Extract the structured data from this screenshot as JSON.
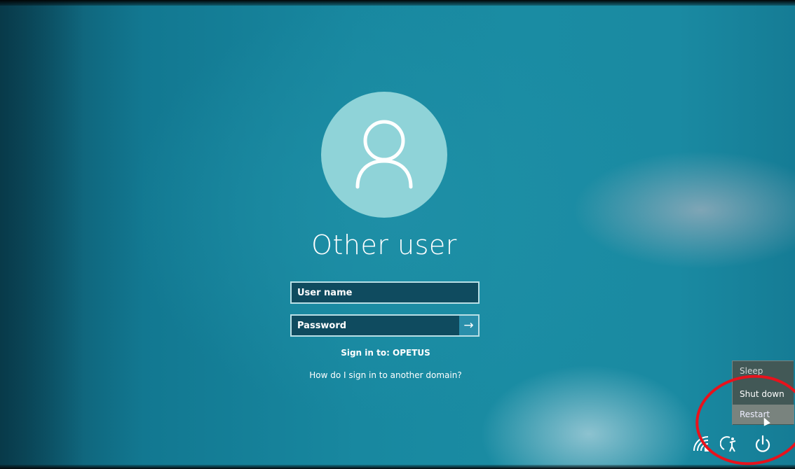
{
  "lock_screen": {
    "avatar_icon": "user-silhouette-icon",
    "title": "Other user",
    "username_placeholder": "User name",
    "password_placeholder": "Password",
    "submit_icon": "arrow-right-icon",
    "submit_glyph": "→",
    "sign_in_to": "Sign in to: OPETUS",
    "domain_help_link": "How do I sign in to another domain?"
  },
  "power_menu": {
    "items": [
      {
        "label": "Sleep"
      },
      {
        "label": "Shut down"
      },
      {
        "label": "Restart",
        "highlighted": true
      }
    ]
  },
  "tray": {
    "icons": [
      "network-icon",
      "ease-of-access-icon",
      "power-icon"
    ]
  },
  "annotation": {
    "circle_color": "#e8121c"
  },
  "colors": {
    "background": "#1888a0",
    "avatar": "#8fd3d8",
    "field_border": "#b9dfe6",
    "field_fill": "#0f4b5f"
  }
}
